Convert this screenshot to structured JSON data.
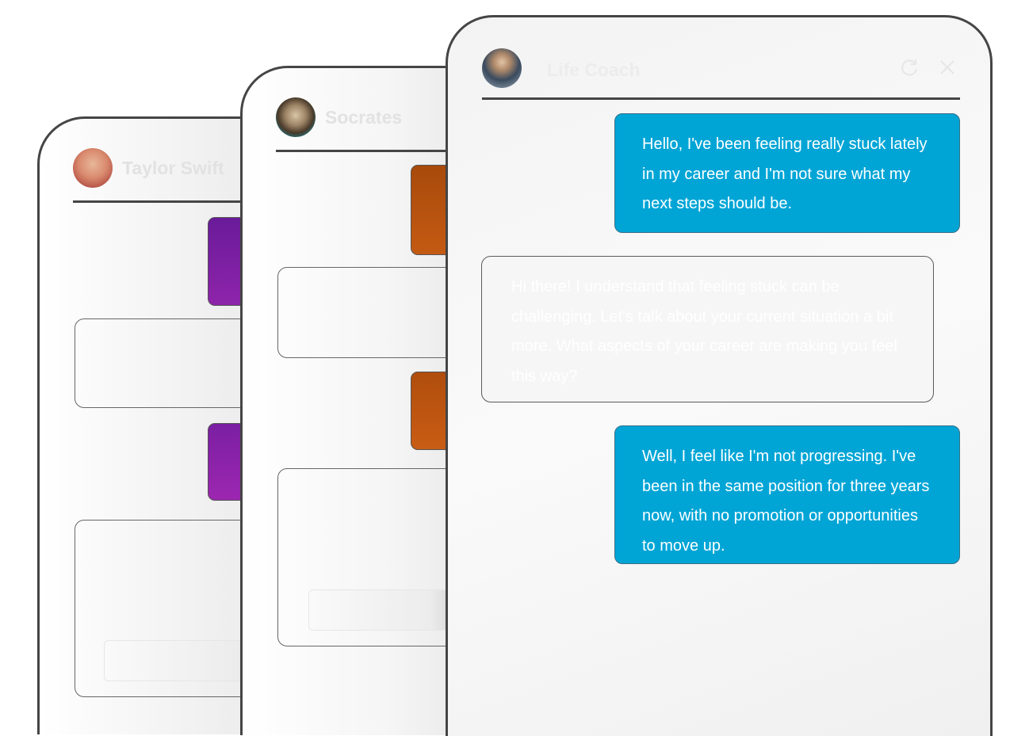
{
  "cards": [
    {
      "name": "Taylor Swift",
      "accent": "#8e24aa"
    },
    {
      "name": "Socrates",
      "accent": "#b54e0a"
    },
    {
      "name": "Life Coach",
      "accent": "#00a5d6"
    }
  ],
  "main_chat": {
    "contact_name": "Life Coach",
    "messages": [
      {
        "role": "user",
        "text": "Hello, I've been feeling really stuck lately in my career and I'm not sure what my next steps should be."
      },
      {
        "role": "assistant",
        "text": "Hi there! I understand that feeling stuck can be challenging. Let's talk about your current situation a bit more. What aspects of your career are making you feel this way?"
      },
      {
        "role": "user",
        "text": "Well, I feel like I'm not progressing. I've been in the same position for three years now, with no promotion or opportunities to move up."
      }
    ],
    "icons": {
      "refresh": "refresh-icon",
      "close": "close-icon"
    }
  },
  "colors": {
    "user_bubble": "#00a5d6",
    "border": "#454545"
  }
}
